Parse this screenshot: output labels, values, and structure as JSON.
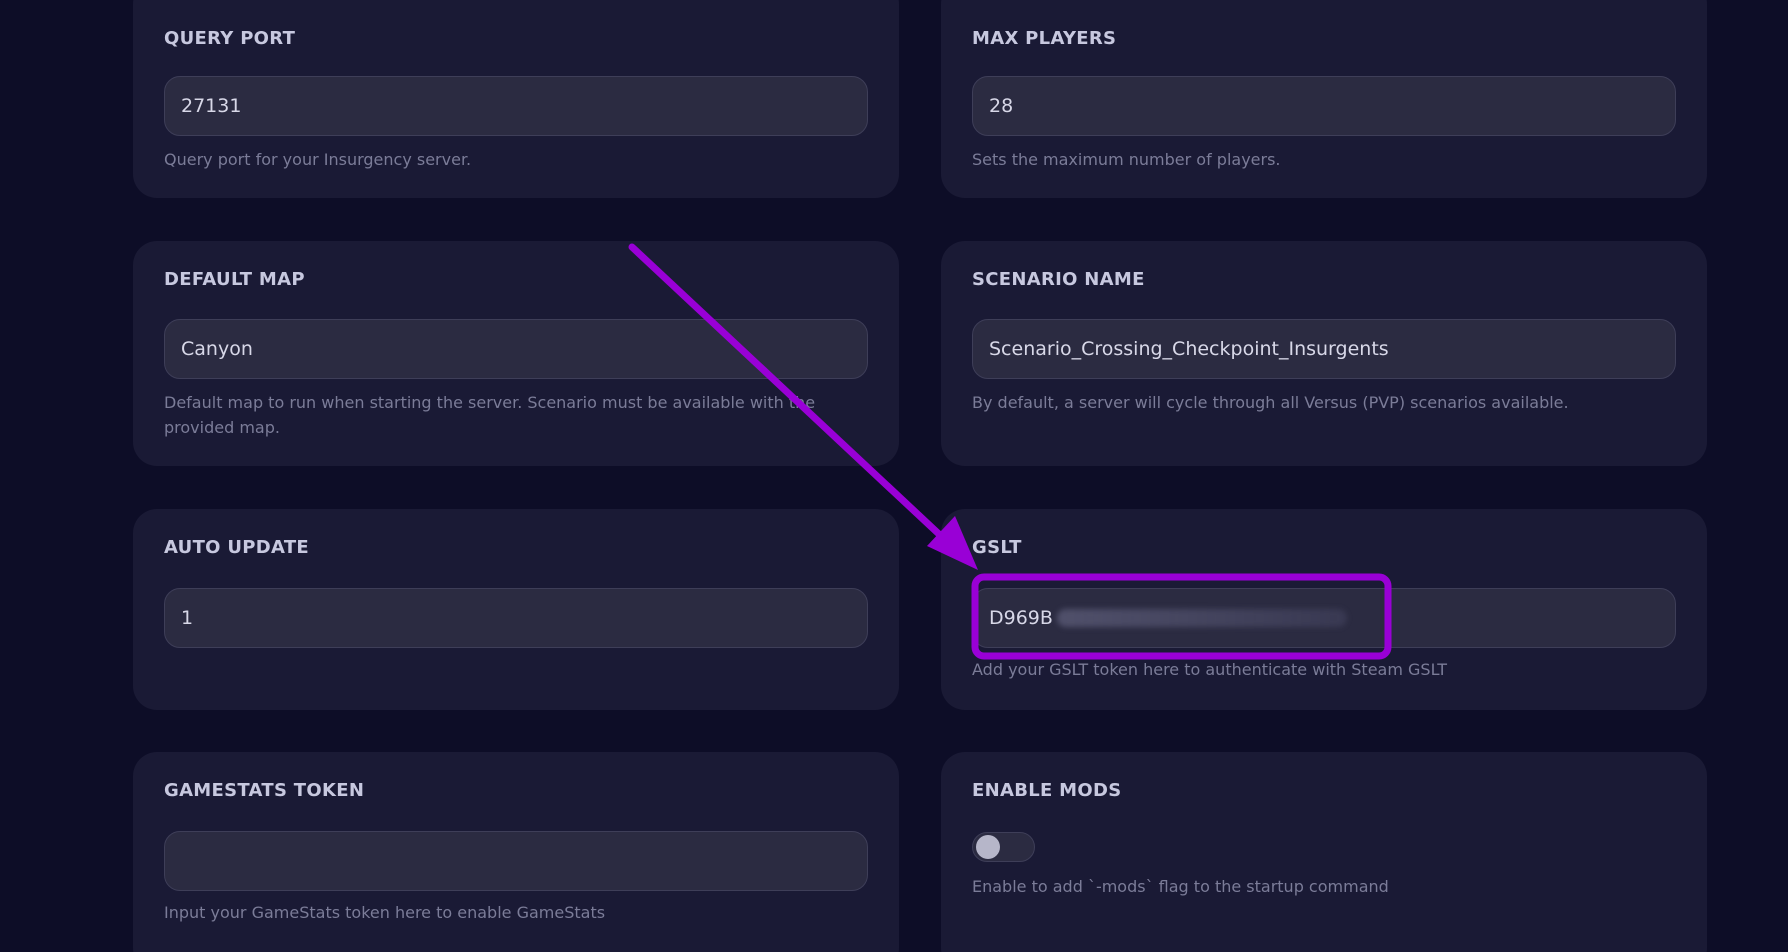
{
  "colors": {
    "background": "#0d0d27",
    "card": "#1a1a35",
    "input": "#2b2b41",
    "annotation": "#9900d6"
  },
  "fields": {
    "query_port": {
      "label": "QUERY PORT",
      "value": "27131",
      "help": "Query port for your Insurgency server."
    },
    "max_players": {
      "label": "MAX PLAYERS",
      "value": "28",
      "help": "Sets the maximum number of players."
    },
    "default_map": {
      "label": "DEFAULT MAP",
      "value": "Canyon",
      "help": "Default map to run when starting the server. Scenario must be available with the provided map."
    },
    "scenario_name": {
      "label": "SCENARIO NAME",
      "value": "Scenario_Crossing_Checkpoint_Insurgents",
      "help": "By default, a server will cycle through all Versus (PVP) scenarios available."
    },
    "auto_update": {
      "label": "AUTO UPDATE",
      "value": "1",
      "help": ""
    },
    "gslt": {
      "label": "GSLT",
      "value": "D969B",
      "help": "Add your GSLT token here to authenticate with Steam GSLT"
    },
    "gamestats_token": {
      "label": "GAMESTATS TOKEN",
      "value": "",
      "help": "Input your GameStats token here to enable GameStats"
    },
    "enable_mods": {
      "label": "ENABLE MODS",
      "enabled": false,
      "help": "Enable to add `-mods` flag to the startup command"
    }
  },
  "annotation": {
    "arrow_icon": "arrow-icon",
    "highlight_target": "gslt-input"
  }
}
